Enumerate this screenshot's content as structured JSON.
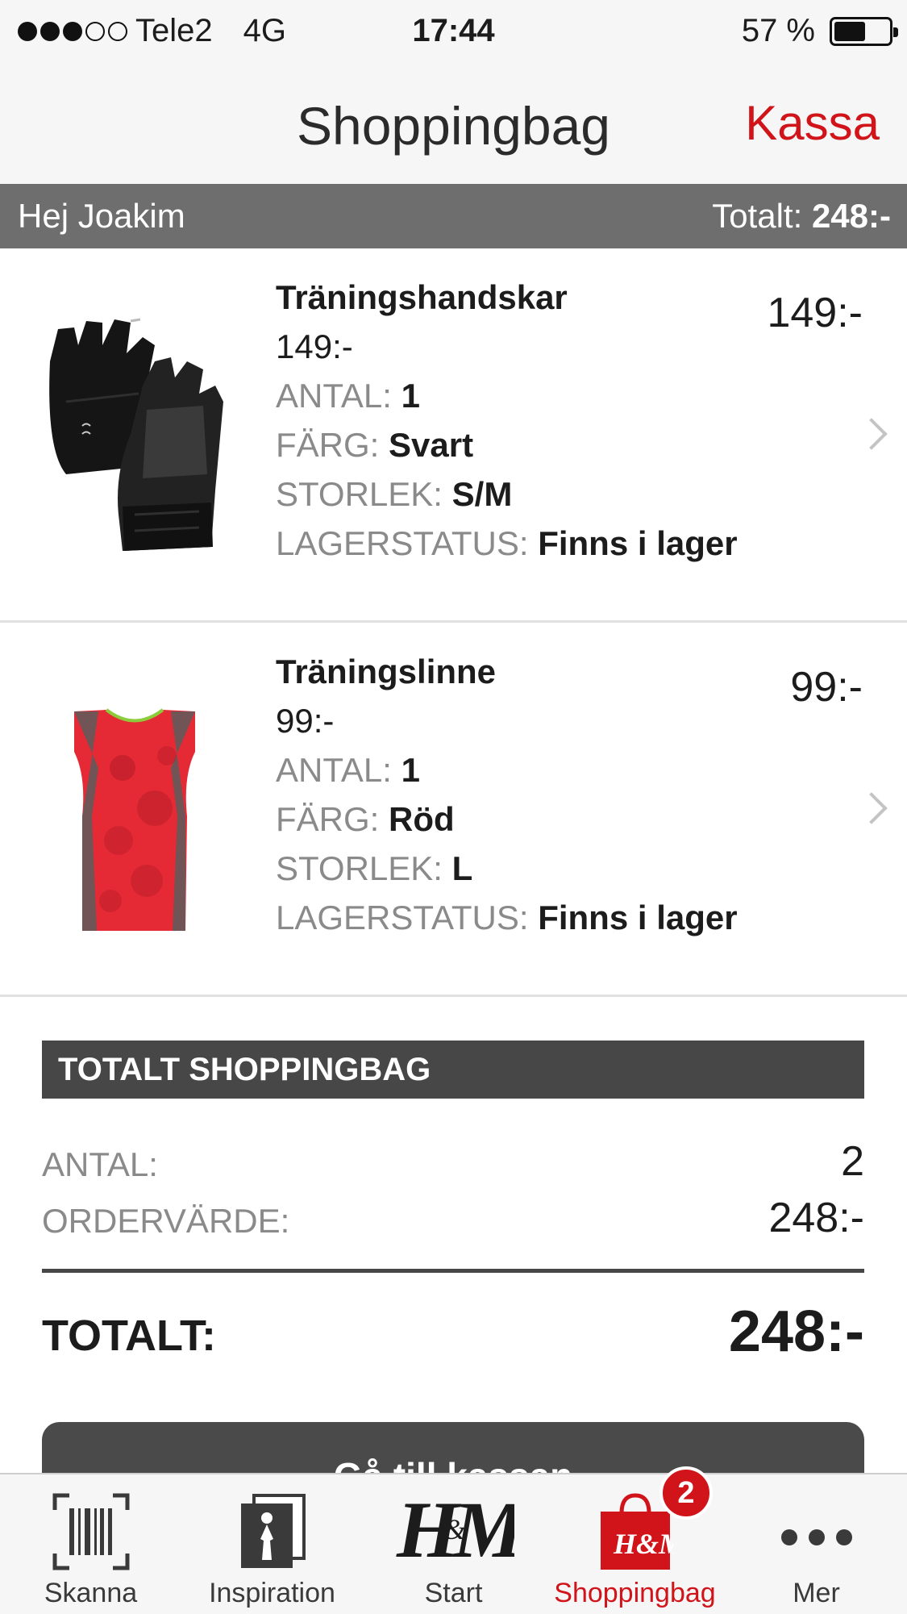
{
  "status_bar": {
    "carrier": "Tele2",
    "network": "4G",
    "time": "17:44",
    "battery_text": "57 %",
    "battery_level": 0.57,
    "signal_bars_filled": 3,
    "signal_bars_total": 5
  },
  "nav": {
    "title": "Shoppingbag",
    "action_label": "Kassa"
  },
  "greeting": {
    "hello": "Hej Joakim",
    "total_label": "Totalt:",
    "total_value": "248:-"
  },
  "labels": {
    "quantity": "ANTAL:",
    "color": "FÄRG:",
    "size": "STORLEK:",
    "stock": "LAGERSTATUS:"
  },
  "items": [
    {
      "name": "Träningshandskar",
      "unit_price": "149:-",
      "quantity": "1",
      "color": "Svart",
      "size": "S/M",
      "stock": "Finns i lager",
      "line_total": "149:-"
    },
    {
      "name": "Träningslinne",
      "unit_price": "99:-",
      "quantity": "1",
      "color": "Röd",
      "size": "L",
      "stock": "Finns i lager",
      "line_total": "99:-"
    }
  ],
  "summary": {
    "header": "TOTALT SHOPPINGBAG",
    "quantity_label": "ANTAL:",
    "quantity_value": "2",
    "order_value_label": "ORDERVÄRDE:",
    "order_value": "248:-",
    "total_label": "TOTALT:",
    "total_value": "248:-"
  },
  "checkout_button": {
    "label": "Gå till kassan"
  },
  "tabs": [
    {
      "label": "Skanna",
      "icon": "barcode-icon"
    },
    {
      "label": "Inspiration",
      "icon": "inspiration-icon"
    },
    {
      "label": "Start",
      "icon": "hm-logo-icon"
    },
    {
      "label": "Shoppingbag",
      "icon": "shopping-bag-icon",
      "active": true
    },
    {
      "label": "Mer",
      "icon": "more-icon"
    }
  ],
  "cart_badge": "2",
  "colors": {
    "brand_red": "#d0141a",
    "dark_gray": "#474747",
    "bar_gray": "#6e6e6e"
  }
}
